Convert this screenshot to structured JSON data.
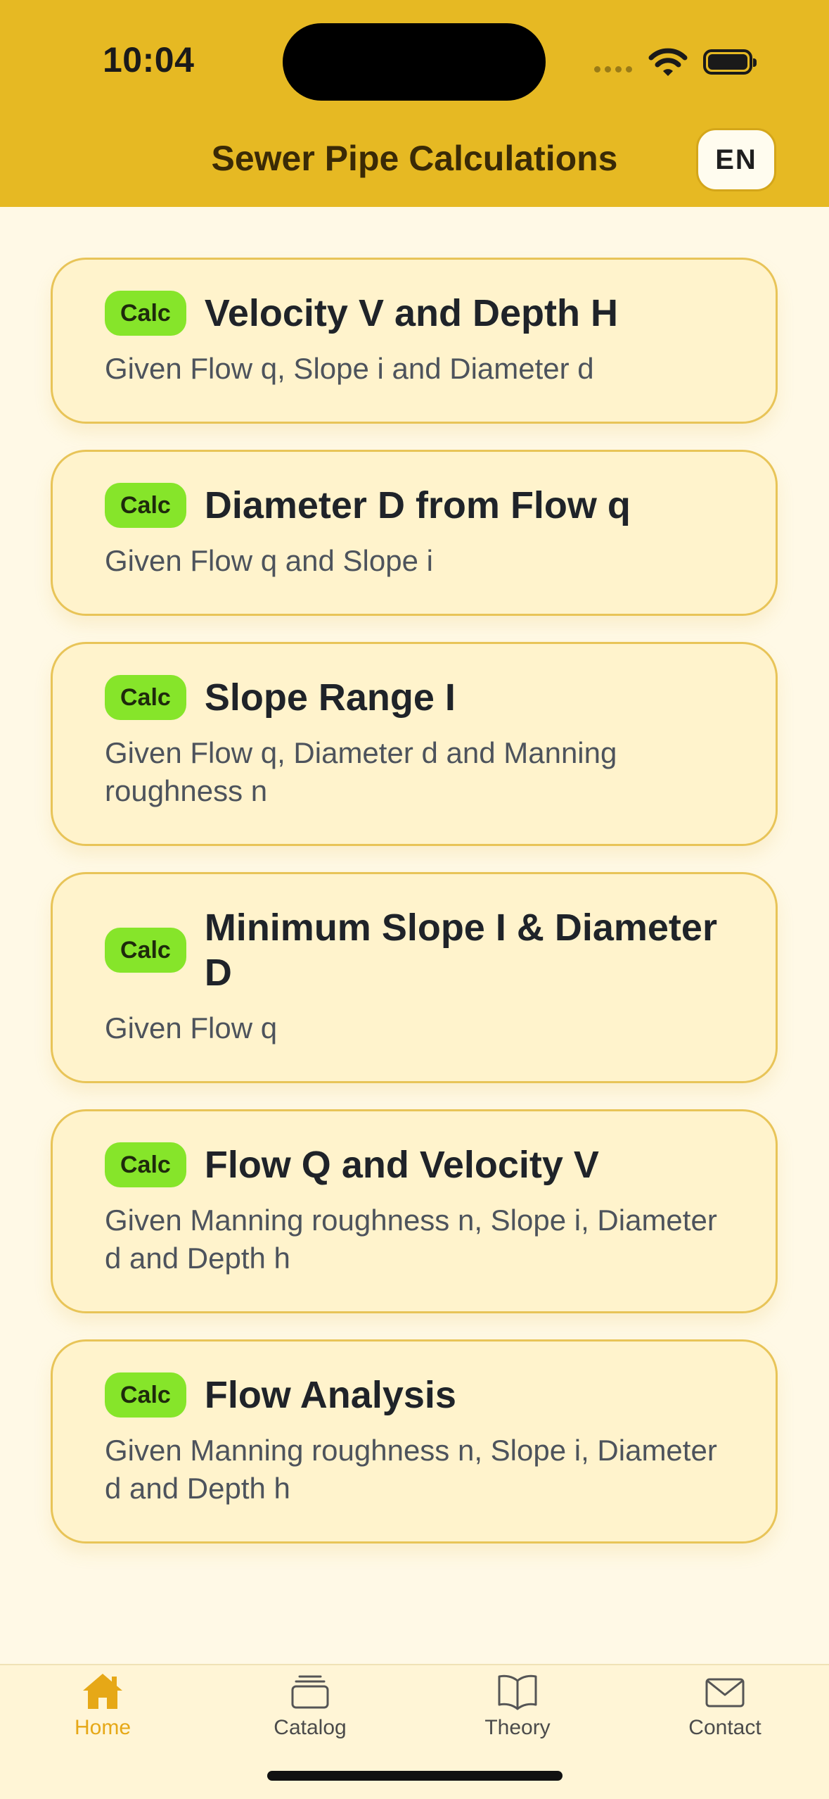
{
  "status_bar": {
    "time": "10:04"
  },
  "header": {
    "title": "Sewer Pipe Calculations",
    "lang_label": "EN"
  },
  "cards": [
    {
      "badge": "Calc",
      "title": "Velocity V and Depth H",
      "subtitle": "Given Flow q, Slope i and Diameter d"
    },
    {
      "badge": "Calc",
      "title": "Diameter D from Flow q",
      "subtitle": "Given Flow q and Slope i"
    },
    {
      "badge": "Calc",
      "title": "Slope Range I",
      "subtitle": "Given Flow q, Diameter d and Manning roughness n"
    },
    {
      "badge": "Calc",
      "title": "Minimum Slope I & Diameter D",
      "subtitle": "Given Flow q"
    },
    {
      "badge": "Calc",
      "title": "Flow Q and Velocity V",
      "subtitle": "Given Manning roughness n, Slope i, Diameter d and Depth h"
    },
    {
      "badge": "Calc",
      "title": "Flow Analysis",
      "subtitle": "Given Manning roughness n, Slope i, Diameter d and Depth h"
    }
  ],
  "tabs": [
    {
      "label": "Home",
      "icon": "home-icon",
      "active": true
    },
    {
      "label": "Catalog",
      "icon": "catalog-icon",
      "active": false
    },
    {
      "label": "Theory",
      "icon": "book-icon",
      "active": false
    },
    {
      "label": "Contact",
      "icon": "mail-icon",
      "active": false
    }
  ],
  "colors": {
    "header_bg": "#E6B923",
    "page_bg": "#FFF9E6",
    "card_bg": "#FFF3CC",
    "card_border": "#E8C458",
    "badge_bg": "#86E52A",
    "active_tab": "#E6A817"
  }
}
